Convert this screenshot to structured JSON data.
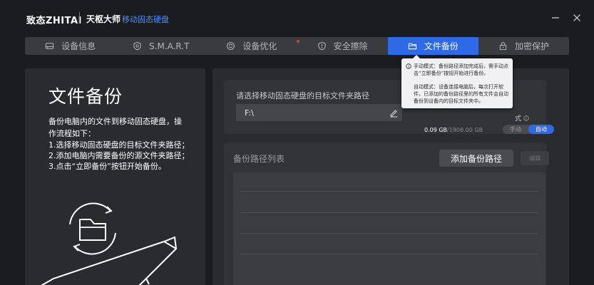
{
  "window": {
    "brand": "致态ZHITAI",
    "app_name": "天枢大师",
    "app_subtitle": "移动固态硬盘"
  },
  "tabs": [
    {
      "label": "设备信息",
      "icon": "drive-icon"
    },
    {
      "label": "S.M.A.R.T",
      "icon": "shield-icon"
    },
    {
      "label": "设备优化",
      "icon": "optimize-icon"
    },
    {
      "label": "安全擦除",
      "icon": "alert-shield-icon"
    },
    {
      "label": "文件备份",
      "icon": "folder-icon",
      "active": true
    },
    {
      "label": "加密保护",
      "icon": "lock-icon"
    }
  ],
  "left_panel": {
    "title": "文件备份",
    "description": "备份电脑内的文件到移动固态硬盘，操作流程如下：",
    "steps": [
      "1.选择移动固态硬盘的目标文件夹路径；",
      "2.添加电脑内需要备份的源文件夹路径；",
      "3.点击“立即备份”按钮开始备份。"
    ]
  },
  "target": {
    "label": "请选择移动固态硬盘的目标文件夹路径",
    "path_value": "F:\\",
    "capacity_used": "0.09 GB",
    "capacity_total": "/1908.00 GB",
    "mode_label_suffix": "式",
    "mode_options": [
      "手动",
      "自动"
    ],
    "mode_selected": "自动"
  },
  "list": {
    "label": "备份路径列表",
    "add_button": "添加备份路径",
    "edit_button": "编辑"
  },
  "tooltip": {
    "manual": "手动模式：备份路径添加完成后，需手动点击“立即备份”按钮开始进行备份。",
    "auto": "自动模式：设备连接电脑后，每次打开软件，已添加的备份路径里的所有文件会自动备份到设备内的目标文件夹中。"
  },
  "colors": {
    "accent": "#2e6ae6",
    "subtitle": "#4d8dff",
    "badge": "#e23b3b"
  }
}
